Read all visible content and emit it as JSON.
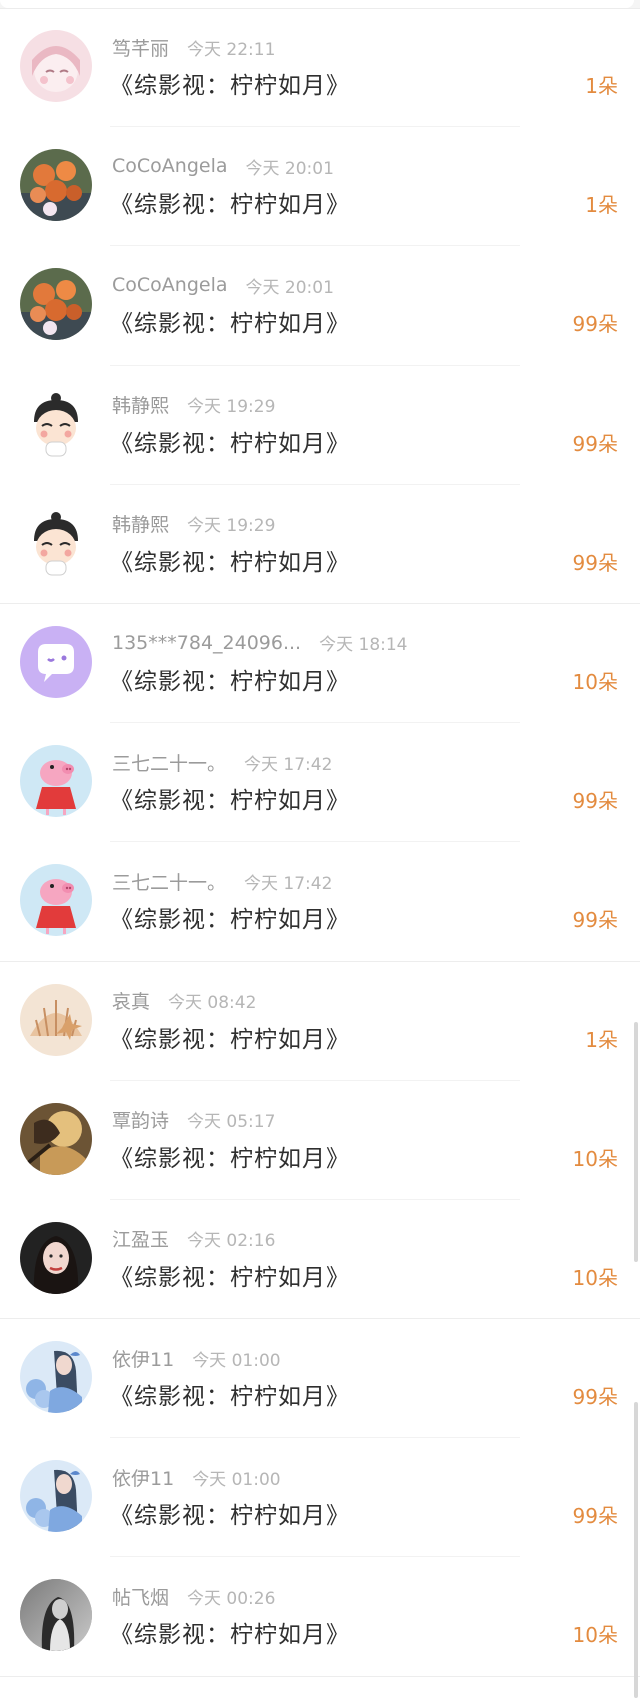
{
  "items": [
    {
      "name": "笃芊丽",
      "time": "今天 22:11",
      "title": "《综影视：柠柠如月》",
      "gift": "1朵",
      "avatar": "anime-girl-avatar"
    },
    {
      "name": "CoCoAngela",
      "time": "今天 20:01",
      "title": "《综影视：柠柠如月》",
      "gift": "1朵",
      "avatar": "orange-roses-avatar"
    },
    {
      "name": "CoCoAngela",
      "time": "今天 20:01",
      "title": "《综影视：柠柠如月》",
      "gift": "99朵",
      "avatar": "orange-roses-avatar"
    },
    {
      "name": "韩静熙",
      "time": "今天 19:29",
      "title": "《综影视：柠柠如月》",
      "gift": "99朵",
      "avatar": "cartoon-kid-avatar"
    },
    {
      "name": "韩静熙",
      "time": "今天 19:29",
      "title": "《综影视：柠柠如月》",
      "gift": "99朵",
      "avatar": "cartoon-kid-avatar"
    },
    {
      "name": "135***784_24096...",
      "time": "今天 18:14",
      "title": "《综影视：柠柠如月》",
      "gift": "10朵",
      "avatar": "chat-bubble-avatar"
    },
    {
      "name": "三七二十一。",
      "time": "今天 17:42",
      "title": "《综影视：柠柠如月》",
      "gift": "99朵",
      "avatar": "pig-cartoon-avatar"
    },
    {
      "name": "三七二十一。",
      "time": "今天 17:42",
      "title": "《综影视：柠柠如月》",
      "gift": "99朵",
      "avatar": "pig-cartoon-avatar"
    },
    {
      "name": "哀真",
      "time": "今天 08:42",
      "title": "《综影视：柠柠如月》",
      "gift": "1朵",
      "avatar": "seashell-avatar"
    },
    {
      "name": "覃韵诗",
      "time": "今天 05:17",
      "title": "《综影视：柠柠如月》",
      "gift": "10朵",
      "avatar": "painting-avatar"
    },
    {
      "name": "江盈玉",
      "time": "今天 02:16",
      "title": "《综影视：柠柠如月》",
      "gift": "10朵",
      "avatar": "portrait-girl-avatar"
    },
    {
      "name": "依伊11",
      "time": "今天 01:00",
      "title": "《综影视：柠柠如月》",
      "gift": "99朵",
      "avatar": "blue-flower-girl-avatar"
    },
    {
      "name": "依伊11",
      "time": "今天 01:00",
      "title": "《综影视：柠柠如月》",
      "gift": "99朵",
      "avatar": "blue-flower-girl-avatar"
    },
    {
      "name": "帖飞烟",
      "time": "今天 00:26",
      "title": "《综影视：柠柠如月》",
      "gift": "10朵",
      "avatar": "bw-girl-avatar"
    }
  ],
  "colors": {
    "gift": "#e38b3f",
    "name": "#9b9b9b",
    "time": "#b6b6b6",
    "title": "#2f2f2f"
  }
}
